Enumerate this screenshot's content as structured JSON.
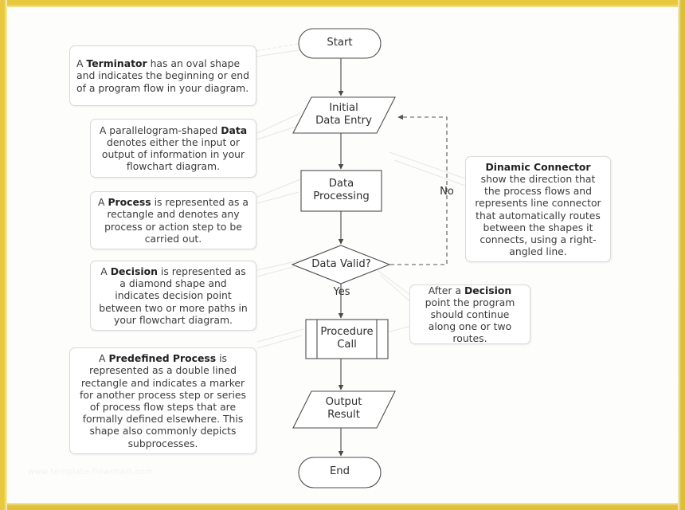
{
  "meta": {
    "title": "Flowchart shapes reference diagram",
    "watermark": "www.template-flowchart.com"
  },
  "colors": {
    "frame": "#e2c53c",
    "canvas": "#fdfdfb",
    "shape_stroke": "#4d4d4d",
    "callout_border": "#d9d9d9",
    "text": "#3b3b3b",
    "connector_faint": "#e4e4e4",
    "connector_dashed": "#555555"
  },
  "flow": {
    "nodes": [
      {
        "id": "start",
        "type": "terminator",
        "label": "Start"
      },
      {
        "id": "initial",
        "type": "data",
        "label": "Initial\nData Entry"
      },
      {
        "id": "processing",
        "type": "process",
        "label": "Data\nProcessing"
      },
      {
        "id": "valid",
        "type": "decision",
        "label": "Data Valid?"
      },
      {
        "id": "procedure",
        "type": "predefined-process",
        "label": "Procedure\nCall"
      },
      {
        "id": "output",
        "type": "data",
        "label": "Output\nResult"
      },
      {
        "id": "end",
        "type": "terminator",
        "label": "End"
      }
    ],
    "edge_labels": {
      "yes": "Yes",
      "no": "No"
    }
  },
  "callouts": [
    {
      "id": "terminator",
      "title": "Terminator",
      "before": "A ",
      "after": " has an oval shape and indicates the beginning or end of a program flow in your diagram.",
      "align": "left"
    },
    {
      "id": "data",
      "title": "Data",
      "before": "A parallelogram-shaped ",
      "after": " denotes either the input or output of information in your flowchart diagram.",
      "align": "center"
    },
    {
      "id": "process",
      "title": "Process",
      "before": "A ",
      "after": " is represented as a rectangle and denotes any process or action step to be carried out.",
      "align": "center"
    },
    {
      "id": "decision",
      "title": "Decision",
      "before": "A ",
      "after": " is represented as a diamond shape and indicates decision point between two or more paths in your flowchart diagram.",
      "align": "center"
    },
    {
      "id": "predefined",
      "title": "Predefined Process",
      "before": "A ",
      "after": " is represented as a double lined rectangle and indicates a marker for another process step or series of process flow steps that are formally defined elsewhere. This shape also commonly depicts subprocesses.",
      "align": "center"
    },
    {
      "id": "connector",
      "title": "Dinamic Connector",
      "before": "",
      "after": "show the direction that the process flows and represents line connector that automatically routes between the shapes it connects, using a right-angled line.",
      "align": "center",
      "title_on_own_line": true
    },
    {
      "id": "after-decision",
      "title": "Decision",
      "before": "After a ",
      "after": " point the program should continue along one or two routes.",
      "align": "center"
    }
  ]
}
